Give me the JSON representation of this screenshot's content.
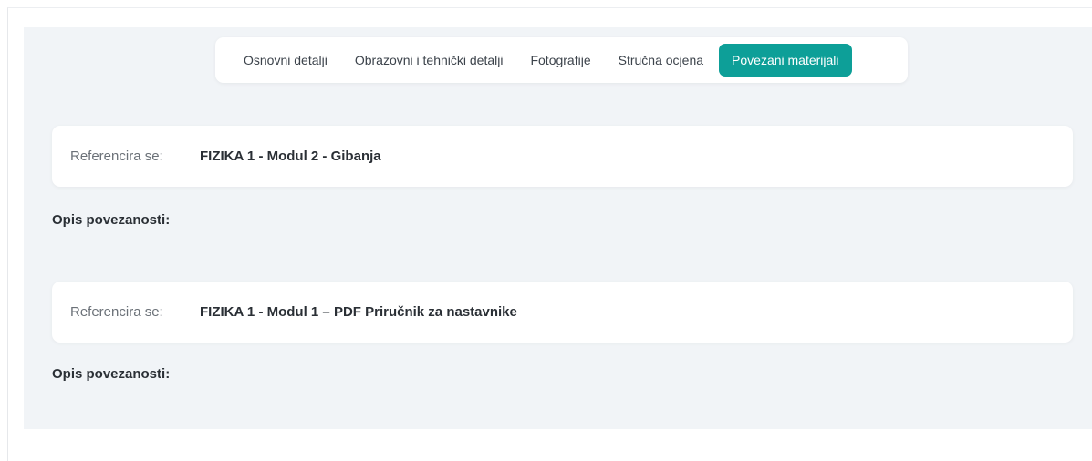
{
  "tabs": [
    {
      "label": "Osnovni detalji",
      "active": false
    },
    {
      "label": "Obrazovni i tehnički detalji",
      "active": false
    },
    {
      "label": "Fotografije",
      "active": false
    },
    {
      "label": "Stručna ocjena",
      "active": false
    },
    {
      "label": "Povezani materijali",
      "active": true
    }
  ],
  "colors": {
    "accent": "#0d9f98",
    "panel_background": "#f1f4f7"
  },
  "related_materials": [
    {
      "reference_label": "Referencira se:",
      "reference_value": "FIZIKA 1 - Modul 2 - Gibanja",
      "description_label": "Opis povezanosti:"
    },
    {
      "reference_label": "Referencira se:",
      "reference_value": "FIZIKA 1 - Modul 1 – PDF Priručnik za nastavnike",
      "description_label": "Opis povezanosti:"
    }
  ]
}
